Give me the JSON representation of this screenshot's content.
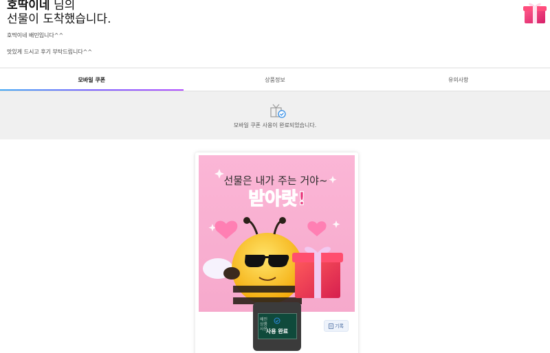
{
  "header": {
    "name": "호딱이네",
    "title_suffix": " 님의",
    "title_line2": "선물이 도착했습니다.",
    "message_line1": "호딱이네 배민입니다^^",
    "message_line2": "맛있게 드시고 후기 부탁드립니다^^"
  },
  "tabs": [
    {
      "label": "모바일 쿠폰",
      "active": true
    },
    {
      "label": "상품정보",
      "active": false
    },
    {
      "label": "유의사항",
      "active": false
    }
  ],
  "status": {
    "text": "모바일 쿠폰 사용이 완료되었습니다."
  },
  "coupon": {
    "headline": "선물은 내가 주는 거야~",
    "shout": "받아랏!",
    "history_button": "기록",
    "used_label": "사용 완료",
    "used_small_text": "배민\n상품\n사용"
  },
  "colors": {
    "accent_gradient_start": "#3fa8f4",
    "accent_gradient_end": "#b14cff",
    "coupon_background": "#f8b8d8",
    "status_band": "#f0f0f0",
    "used_overlay": "#3b3b3b",
    "used_inner": "#0f4a3b"
  },
  "icons": {
    "header_gift": "gift-box-icon",
    "status": "gift-check-icon",
    "history": "document-icon",
    "used_check": "check-circle-icon"
  }
}
